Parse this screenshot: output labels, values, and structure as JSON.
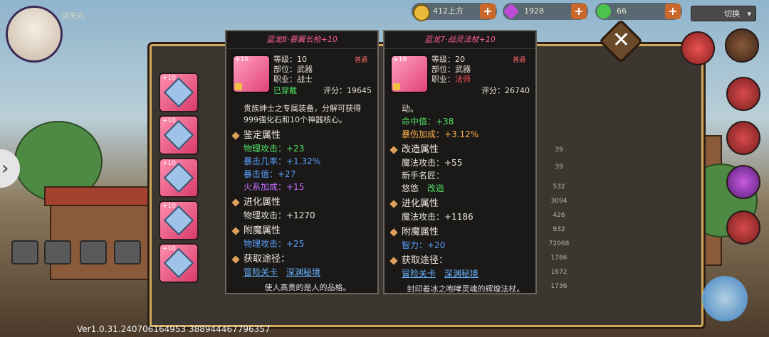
{
  "topbar": {
    "player_name": "讲天丸",
    "resources": [
      {
        "icon": "gold-coin-icon",
        "value": "412上方"
      },
      {
        "icon": "gem-icon",
        "value": "1928"
      },
      {
        "icon": "energy-heart-icon",
        "value": "66"
      }
    ],
    "switch_label": "切换"
  },
  "left_item": {
    "title": "蓝龙8·暴翼长枪+10",
    "level_label": "等级：10",
    "slot_label": "部位：武器",
    "job_label": "职业：战士",
    "badge": "普通",
    "equipped": "已穿戴",
    "score": "评分：19645",
    "icon_level": "+10",
    "description": "贵族绅士之专属装备，分解可获得999强化石和10个神器核心。",
    "identify_title": "鉴定属性",
    "identify_lines": [
      {
        "text": "物理攻击：+23",
        "color": "green"
      },
      {
        "text": "暴击几率：+1.32%",
        "color": "blue"
      },
      {
        "text": "暴击值：+27",
        "color": "blue"
      },
      {
        "text": "火系加成：+15",
        "color": "purple"
      }
    ],
    "evolve_title": "进化属性",
    "evolve_lines": [
      {
        "text": "物理攻击：+1270",
        "color": "white"
      }
    ],
    "enchant_title": "附魔属性",
    "enchant_lines": [
      {
        "text": "物理攻击：+25",
        "color": "blue"
      }
    ],
    "source_title": "获取途径：",
    "source_links": [
      "冒险关卡",
      "深渊秘境"
    ],
    "quote": "使人高贵的是人的品格。"
  },
  "right_item": {
    "title": "蓝龙7·战灵法杖+10",
    "level_label": "等级：20",
    "slot_label": "部位：武器",
    "job_label_prefix": "职业：",
    "job_value": "法师",
    "badge": "普通",
    "score": "评分：26740",
    "icon_level": "+10",
    "description_tail": "动。",
    "top_lines": [
      {
        "text": "命中值：+38",
        "color": "green"
      },
      {
        "text": "暴伤加成：+3.12%",
        "color": "orange"
      }
    ],
    "reform_title": "改造属性",
    "reform_lines": [
      {
        "text": "魔法攻击：+55",
        "color": "white"
      },
      {
        "text": "新手名匠：",
        "color": "white"
      }
    ],
    "reform_row_label": "悠悠",
    "reform_row_link": "改造",
    "evolve_title": "进化属性",
    "evolve_lines": [
      {
        "text": "魔法攻击：+1186",
        "color": "white"
      }
    ],
    "enchant_title": "附魔属性",
    "enchant_lines": [
      {
        "text": "智力：+20",
        "color": "blue"
      }
    ],
    "source_title": "获取途径：",
    "source_links": [
      "冒险关卡",
      "深渊秘境"
    ],
    "quote": "封印着冰之咆哮灵魂的辉煌法杖。"
  },
  "equipment_slots": [
    {
      "level": "+10",
      "icon": "helmet-icon"
    },
    {
      "level": "+10",
      "icon": "feather-wing-icon"
    },
    {
      "level": "+10",
      "icon": "armor-icon"
    },
    {
      "level": "+10",
      "icon": "glove-icon"
    },
    {
      "level": "+10",
      "icon": "boots-icon"
    }
  ],
  "right_panel_values": [
    "39",
    "39",
    "532",
    "3094",
    "426",
    "932",
    "72068",
    "1786",
    "1672",
    "1736"
  ],
  "version": "Ver1.0.31.240706164953 388944467796357",
  "close_label": "✕"
}
